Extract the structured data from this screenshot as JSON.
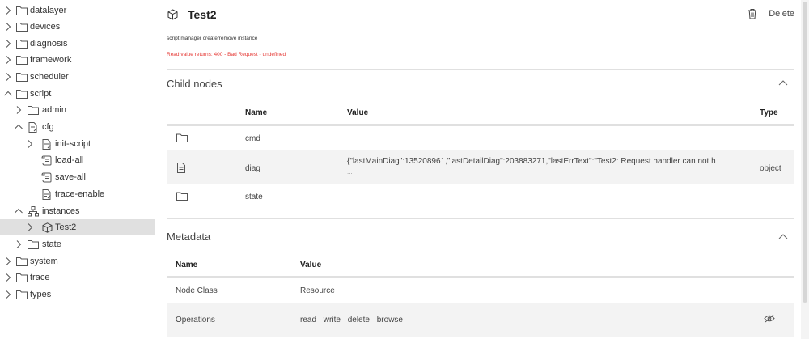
{
  "tree": {
    "items": [
      {
        "label": "datalayer"
      },
      {
        "label": "devices"
      },
      {
        "label": "diagnosis"
      },
      {
        "label": "framework"
      },
      {
        "label": "scheduler"
      },
      {
        "label": "script"
      },
      {
        "label": "admin"
      },
      {
        "label": "cfg"
      },
      {
        "label": "init-script"
      },
      {
        "label": "load-all"
      },
      {
        "label": "save-all"
      },
      {
        "label": "trace-enable"
      },
      {
        "label": "instances"
      },
      {
        "label": "Test2"
      },
      {
        "label": "state"
      },
      {
        "label": "system"
      },
      {
        "label": "trace"
      },
      {
        "label": "types"
      }
    ]
  },
  "header": {
    "title": "Test2",
    "delete_label": "Delete",
    "subline": "script manager create/remove instance",
    "error": "Read value returns: 400 - Bad Request - undefined"
  },
  "child_nodes": {
    "title": "Child nodes",
    "columns": {
      "name": "Name",
      "value": "Value",
      "type": "Type"
    },
    "rows": [
      {
        "name": "cmd",
        "value": "",
        "value2": "",
        "type": ""
      },
      {
        "name": "diag",
        "value": "{\"lastMainDiag\":135208961,\"lastDetailDiag\":203883271,\"lastErrText\":\"Test2: Request handler can not h",
        "value2": "...",
        "type": "object"
      },
      {
        "name": "state",
        "value": "",
        "value2": "",
        "type": ""
      }
    ]
  },
  "metadata": {
    "title": "Metadata",
    "columns": {
      "name": "Name",
      "value": "Value"
    },
    "rows": [
      {
        "name": "Node Class",
        "value": "Resource"
      },
      {
        "name": "Operations",
        "ops": [
          "read",
          "write",
          "delete",
          "browse"
        ]
      }
    ]
  },
  "icons": {
    "folder": "folder-icon",
    "file": "file-edit-icon",
    "script": "script-file-icon",
    "cube": "cube-icon",
    "network": "network-icon",
    "trash": "trash-icon",
    "eye_off": "eye-off-icon"
  }
}
